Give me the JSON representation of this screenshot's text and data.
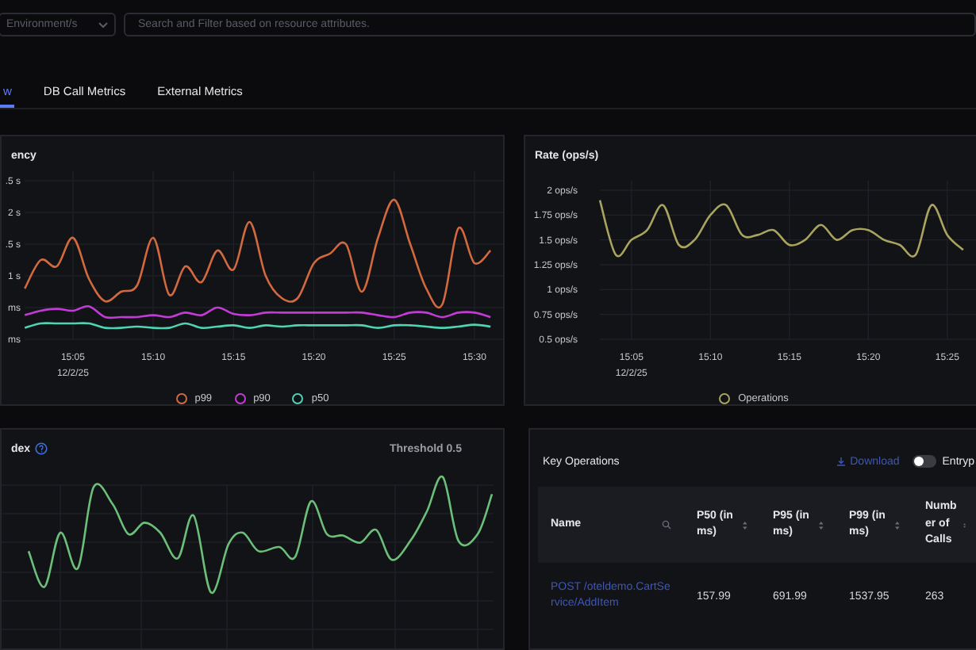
{
  "filters": {
    "environment": {
      "placeholder": "Environment/s"
    },
    "search": {
      "placeholder": "Search and Filter based on resource attributes."
    }
  },
  "tabs": [
    {
      "label": "w",
      "selected": true
    },
    {
      "label": "DB Call Metrics",
      "selected": false
    },
    {
      "label": "External Metrics",
      "selected": false
    }
  ],
  "latency_panel": {
    "title": "ency",
    "clipped_axis_labels": [
      ".5 s",
      ".5 s"
    ],
    "date_label": "12/2/25",
    "chart_data": {
      "type": "line",
      "grid": true,
      "categories": [
        null,
        null,
        null,
        "15:05",
        null,
        null,
        null,
        null,
        "15:10",
        null,
        null,
        null,
        null,
        "15:15",
        null,
        null,
        null,
        null,
        "15:20",
        null,
        null,
        null,
        null,
        "15:25",
        null,
        null,
        null,
        null,
        "15:30",
        null
      ],
      "ylim": [
        0,
        2.5
      ],
      "yticks": [
        {
          "value": 2,
          "label": "2 s"
        },
        {
          "value": 1,
          "label": "1 s"
        },
        {
          "value": 0.5,
          "label": "ms"
        },
        {
          "value": 0,
          "label": "ms"
        }
      ],
      "series": [
        {
          "name": "p99",
          "color": "#d2693f",
          "values": [
            0.8,
            1.25,
            1.15,
            1.6,
            0.95,
            0.6,
            0.75,
            0.85,
            1.6,
            0.7,
            1.15,
            0.9,
            1.4,
            1.1,
            1.85,
            1.0,
            0.65,
            0.65,
            1.2,
            1.35,
            1.5,
            0.75,
            1.6,
            2.2,
            1.5,
            0.8,
            0.55,
            1.75,
            1.2,
            1.4
          ]
        },
        {
          "name": "p90",
          "color": "#c23bd6",
          "values": [
            0.38,
            0.45,
            0.48,
            0.45,
            0.52,
            0.35,
            0.35,
            0.35,
            0.38,
            0.35,
            0.42,
            0.38,
            0.5,
            0.4,
            0.38,
            0.42,
            0.42,
            0.42,
            0.42,
            0.42,
            0.42,
            0.42,
            0.38,
            0.35,
            0.42,
            0.42,
            0.35,
            0.42,
            0.42,
            0.35
          ]
        },
        {
          "name": "p50",
          "color": "#4fd3b2",
          "values": [
            0.18,
            0.25,
            0.25,
            0.25,
            0.25,
            0.18,
            0.18,
            0.2,
            0.18,
            0.18,
            0.25,
            0.18,
            0.2,
            0.22,
            0.18,
            0.22,
            0.2,
            0.22,
            0.22,
            0.22,
            0.22,
            0.22,
            0.18,
            0.22,
            0.22,
            0.2,
            0.18,
            0.2,
            0.23,
            0.2
          ]
        }
      ]
    }
  },
  "rate_panel": {
    "title": "Rate (ops/s)",
    "date_label": "12/2/25",
    "chart_data": {
      "type": "line",
      "grid": true,
      "categories": [
        null,
        null,
        "15:05",
        null,
        null,
        null,
        null,
        "15:10",
        null,
        null,
        null,
        null,
        "15:15",
        null,
        null,
        null,
        null,
        "15:20",
        null,
        null,
        null,
        null,
        "15:25",
        null
      ],
      "ylim": [
        0.5,
        2
      ],
      "yticks": [
        {
          "value": 2,
          "label": "2 ops/s"
        },
        {
          "value": 1.75,
          "label": "1.75 ops/s"
        },
        {
          "value": 1.5,
          "label": "1.5 ops/s"
        },
        {
          "value": 1.25,
          "label": "1.25 ops/s"
        },
        {
          "value": 1,
          "label": "1 ops/s"
        },
        {
          "value": 0.75,
          "label": "0.75 ops/s"
        },
        {
          "value": 0.5,
          "label": "0.5 ops/s"
        }
      ],
      "series": [
        {
          "name": "Operations",
          "color": "#a9a45e",
          "values": [
            1.9,
            1.35,
            1.5,
            1.6,
            1.85,
            1.45,
            1.5,
            1.75,
            1.85,
            1.55,
            1.55,
            1.6,
            1.45,
            1.5,
            1.65,
            1.5,
            1.6,
            1.6,
            1.5,
            1.45,
            1.35,
            1.85,
            1.55,
            1.4
          ]
        }
      ]
    }
  },
  "apdex_panel": {
    "title": "dex",
    "threshold": "Threshold 0.5"
  },
  "key_operations": {
    "title": "Key Operations",
    "download": "Download",
    "entrypoint_toggle": {
      "label": "Entryp",
      "on": false
    },
    "columns": [
      "Name",
      "P50 (in ms)",
      "P95 (in ms)",
      "P99 (in ms)",
      "Number of Calls"
    ],
    "rows": [
      {
        "name": "POST /oteldemo.CartService/AddItem",
        "p50": "157.99",
        "p95": "691.99",
        "p99": "1537.95",
        "calls": "263"
      }
    ]
  }
}
